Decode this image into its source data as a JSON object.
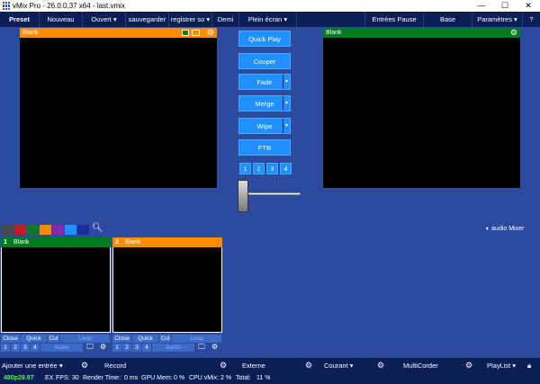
{
  "window": {
    "title": "vMix Pro - 26.0.0.37 x64 - last.vmix",
    "min": "—",
    "max": "☐",
    "close": "✕"
  },
  "menu": {
    "preset": "Preset",
    "nouveau": "Nouveau",
    "ouvert": "Ouvert",
    "sauvegarder": "sauvegarder",
    "registrer": "registrer so",
    "demi": "Demi",
    "plein_ecran": "Plein écran",
    "entrees_pause": "Entrées Pause",
    "base": "Base",
    "parametres": "Paramètres",
    "help": "?"
  },
  "preview": {
    "label": "Blank",
    "header_color": "#ff8c00"
  },
  "output": {
    "label": "Blank",
    "header_color": "#007a1f"
  },
  "transitions": {
    "quick_play": "Quick Play",
    "couper": "Couper",
    "fade": "Fade",
    "merge": "Merge",
    "wipe": "Wipe",
    "ftb": "FTB",
    "numbers": [
      "1",
      "2",
      "3",
      "4"
    ]
  },
  "color_swatches": [
    "#4a4a4a",
    "#c01d1d",
    "#0f7a2b",
    "#ff8c00",
    "#8a2aa8",
    "#1e90ff",
    "#1a2f9a"
  ],
  "audio_mixer": "audio Mixer",
  "inputs": [
    {
      "number": "1",
      "label": "Blank",
      "header_color": "#007a1f",
      "controls": [
        "Close",
        "Quick Play",
        "Cut",
        "Loop"
      ],
      "nums": [
        "1",
        "2",
        "3",
        "4"
      ],
      "audio": "Audio"
    },
    {
      "number": "2",
      "label": "Blank",
      "header_color": "#ff8c00",
      "controls": [
        "Close",
        "Quick Play",
        "Cut",
        "Loop"
      ],
      "nums": [
        "1",
        "2",
        "3",
        "4"
      ],
      "audio": "Audio"
    }
  ],
  "bottom": {
    "ajouter": "Ajouter une entrée",
    "record": "Record",
    "externe": "Externe",
    "courant": "Courant",
    "multicorder": "MultiCorder",
    "playlist": "PlayList"
  },
  "status": {
    "resolution": "480p29.97",
    "ex": "EX",
    "fps_label": "FPS:",
    "fps": "30",
    "render_label": "Render Time:",
    "render": "0 ms",
    "gpu_label": "GPU Mem:",
    "gpu": "0 %",
    "cpu_label": "CPU vMix:",
    "cpu": "2 %",
    "total_label": "Total:",
    "total": "11 %"
  }
}
